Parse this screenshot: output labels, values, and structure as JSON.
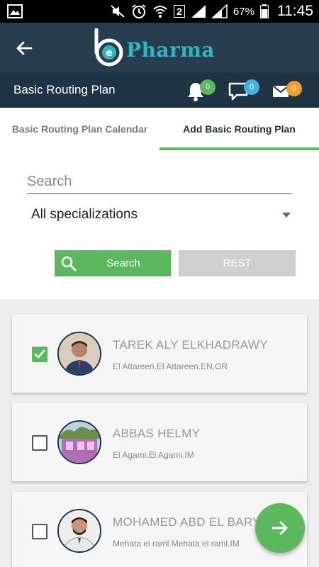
{
  "status_bar": {
    "battery": "67%",
    "time": "11:45",
    "sim_label": "2",
    "icons": [
      "gallery-icon",
      "mute-icon",
      "alarm-icon",
      "wifi-icon",
      "signal-icon",
      "battery-icon"
    ]
  },
  "header": {
    "back_icon": "arrow-left-icon",
    "logo_text": "Pharma"
  },
  "subheader": {
    "title": "Basic Routing Plan",
    "notifications_count": "0",
    "messages_count": "0",
    "mail_count": "0",
    "badge_colors": {
      "notifications": "#5cb85c",
      "messages": "#4aaee0",
      "mail": "#f0a030"
    }
  },
  "tabs": [
    {
      "label": "Basic Routing Plan Calendar",
      "active": false
    },
    {
      "label": "Add Basic Routing Plan",
      "active": true
    }
  ],
  "search": {
    "placeholder": "Search",
    "value": "",
    "specialization": "All specializations",
    "search_button": "Search",
    "reset_button": "REST"
  },
  "doctors": [
    {
      "name": "TAREK ALY ELKHADRAWY",
      "address": "El Attareen.El Attareen.EN,OR",
      "checked": true
    },
    {
      "name": "ABBAS HELMY",
      "address": "El Agami.El Agami.IM",
      "checked": false
    },
    {
      "name": "MOHAMED ABD EL BARY",
      "address": "Mehata el raml.Mehata el raml.IM",
      "checked": false
    }
  ],
  "fab": {
    "icon": "arrow-right-icon"
  },
  "colors": {
    "primary_dark": "#1e3344",
    "header": "#273c4d",
    "accent_green": "#5cb85c",
    "logo_teal": "#29b8c2"
  }
}
